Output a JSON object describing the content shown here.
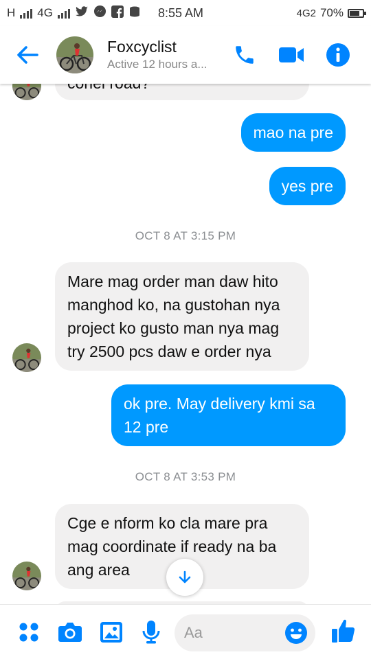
{
  "status_bar": {
    "network_left": "H",
    "network_mid": "4G",
    "time": "8:55 AM",
    "network_right": "4G2",
    "battery": "70%",
    "battery_level": 0.7
  },
  "header": {
    "name": "Foxcyclist",
    "status": "Active 12 hours a...",
    "accent": "#0084ff"
  },
  "messages": {
    "partial_in_text": "conei road?",
    "out1": "mao na pre",
    "out2": "yes pre",
    "ts1": "OCT 8 AT 3:15 PM",
    "in1_lines": [
      "Mare mag order man daw hito",
      "manghod ko, na gustohan nya",
      "project ko gusto man nya mag",
      "try 2500 pcs daw e order nya"
    ],
    "out3_lines": [
      "ok pre. May delivery kmi sa",
      "12 pre"
    ],
    "ts2": "OCT 8 AT 3:53 PM",
    "in2_lines": [
      "Cge e nform ko cla mare pra",
      "mag coordinate if ready na ba",
      "ang area"
    ]
  },
  "composer": {
    "placeholder": "Aa"
  },
  "colors": {
    "outgoing_bubble": "#0099ff",
    "incoming_bubble": "#f1f0f0",
    "icon_blue": "#0084ff"
  }
}
